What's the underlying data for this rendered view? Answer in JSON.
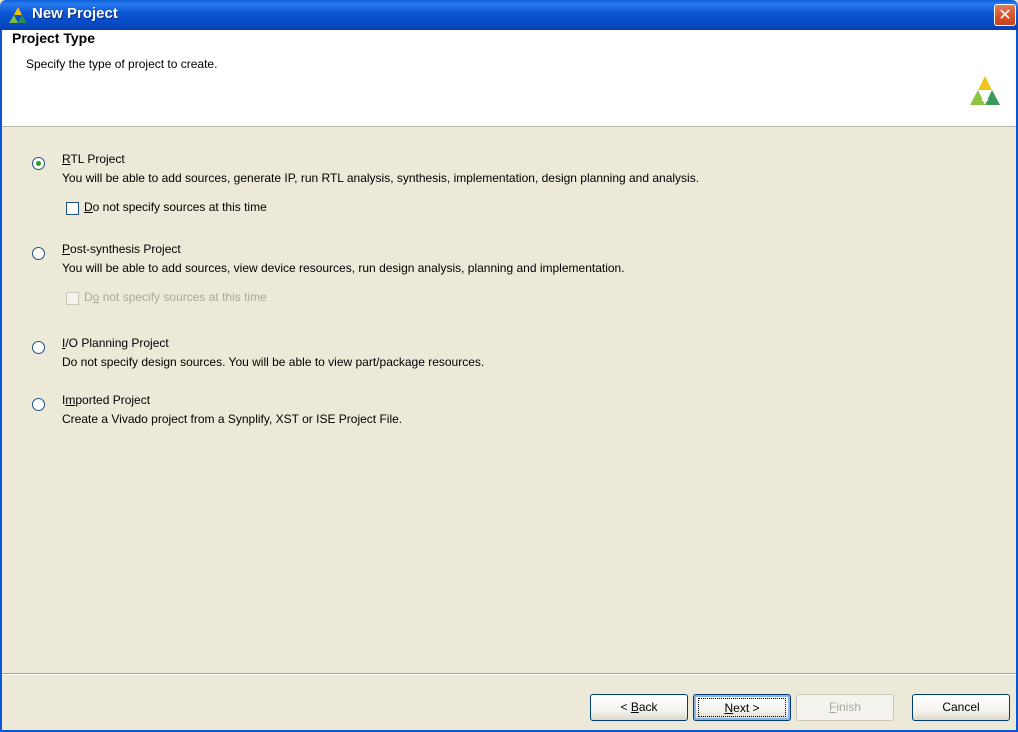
{
  "window": {
    "title": "New Project",
    "close_symbol": "✕"
  },
  "header": {
    "title": "Project Type",
    "subtitle": "Specify the type of project to create."
  },
  "options": [
    {
      "label_key": "R",
      "label_rest": "TL Project",
      "description": "You will be able to add sources, generate IP, run RTL analysis, synthesis, implementation, design planning and analysis.",
      "selected": true,
      "checkbox": {
        "key": "D",
        "rest": "o not specify sources at this time",
        "checked": false,
        "enabled": true
      }
    },
    {
      "label_key": "P",
      "label_rest": "ost-synthesis Project",
      "description": "You will be able to add sources, view device resources, run design analysis, planning and implementation.",
      "selected": false,
      "checkbox": {
        "key_pre": "D",
        "key": "o",
        "rest": " not specify sources at this time",
        "checked": false,
        "enabled": false
      }
    },
    {
      "label_key": "I",
      "label_rest": "/O Planning Project",
      "description": "Do not specify design sources. You will be able to view part/package resources.",
      "selected": false
    },
    {
      "label_pre": "I",
      "label_key": "m",
      "label_rest": "ported Project",
      "description": "Create a Vivado project from a Synplify, XST or ISE Project File.",
      "selected": false
    }
  ],
  "buttons": {
    "back": {
      "pre": "< ",
      "key": "B",
      "rest": "ack"
    },
    "next": {
      "key": "N",
      "rest": "ext >"
    },
    "finish": {
      "key": "F",
      "rest": "inish"
    },
    "cancel": "Cancel"
  },
  "colors": {
    "titlebar": "#0b56d3",
    "dialog_bg": "#ece9d8",
    "radio_dot": "#21a121"
  },
  "icons": {
    "app": "vivado-logo-icon",
    "close": "close-icon",
    "header_logo": "vivado-logo-icon"
  }
}
